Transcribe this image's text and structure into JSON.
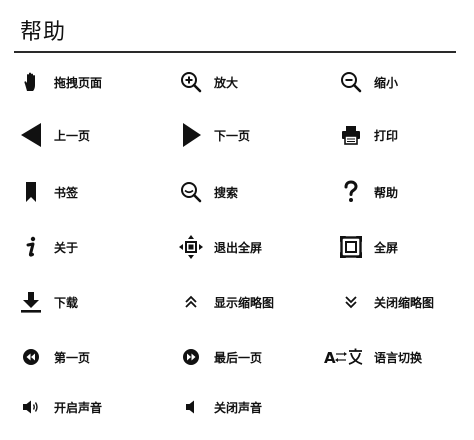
{
  "title": "帮助",
  "items": [
    {
      "label": "拖拽页面",
      "icon": "hand-icon"
    },
    {
      "label": "放大",
      "icon": "zoom-in-icon"
    },
    {
      "label": "缩小",
      "icon": "zoom-out-icon"
    },
    {
      "label": "上一页",
      "icon": "triangle-left-icon"
    },
    {
      "label": "下一页",
      "icon": "triangle-right-icon"
    },
    {
      "label": "打印",
      "icon": "printer-icon"
    },
    {
      "label": "书签",
      "icon": "bookmark-icon"
    },
    {
      "label": "搜索",
      "icon": "search-icon"
    },
    {
      "label": "帮助",
      "icon": "question-icon"
    },
    {
      "label": "关于",
      "icon": "info-icon"
    },
    {
      "label": "退出全屏",
      "icon": "exit-fullscreen-icon"
    },
    {
      "label": "全屏",
      "icon": "fullscreen-icon"
    },
    {
      "label": "下载",
      "icon": "download-icon"
    },
    {
      "label": "显示缩略图",
      "icon": "chevron-up-double-icon"
    },
    {
      "label": "关闭缩略图",
      "icon": "chevron-down-double-icon"
    },
    {
      "label": "第一页",
      "icon": "first-page-icon"
    },
    {
      "label": "最后一页",
      "icon": "last-page-icon"
    },
    {
      "label": "语言切换",
      "icon": "language-switch-icon"
    },
    {
      "label": "开启声音",
      "icon": "volume-on-icon"
    },
    {
      "label": "关闭声音",
      "icon": "volume-off-icon"
    }
  ]
}
